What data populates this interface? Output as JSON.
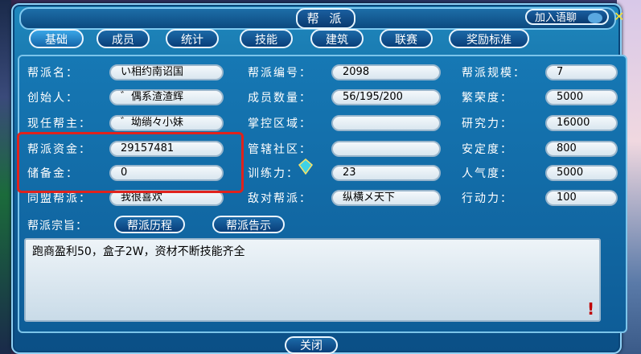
{
  "window": {
    "title": "帮 派",
    "chat_button_label": "加入语聊",
    "close_symbol": "✕"
  },
  "tabs": [
    {
      "label": "基础",
      "active": true
    },
    {
      "label": "成员",
      "active": false
    },
    {
      "label": "统计",
      "active": false
    },
    {
      "label": "技能",
      "active": false
    },
    {
      "label": "建筑",
      "active": false
    },
    {
      "label": "联赛",
      "active": false
    },
    {
      "label": "奖励标准",
      "active": false
    }
  ],
  "info": {
    "col1": [
      {
        "label": "帮派名：",
        "value": "い相约南诏国"
      },
      {
        "label": "创始人：",
        "value": "゛偶系渣渣辉"
      },
      {
        "label": "现任帮主：",
        "value": "゛坳绱々小妹"
      },
      {
        "label": "帮派资金：",
        "value": "29157481"
      },
      {
        "label": "储备金：",
        "value": "0"
      },
      {
        "label": "同盟帮派：",
        "value": "我很喜欢"
      }
    ],
    "col2": [
      {
        "label": "帮派编号：",
        "value": "2098"
      },
      {
        "label": "成员数量：",
        "value": "56/195/200"
      },
      {
        "label": "掌控区域：",
        "value": ""
      },
      {
        "label": "管辖社区：",
        "value": ""
      },
      {
        "label": "训练力：",
        "value": "23"
      },
      {
        "label": "敌对帮派：",
        "value": "纵横メ天下"
      }
    ],
    "col3": [
      {
        "label": "帮派规模：",
        "value": "7"
      },
      {
        "label": "繁荣度：",
        "value": "5000"
      },
      {
        "label": "研究力：",
        "value": "16000"
      },
      {
        "label": "安定度：",
        "value": "800"
      },
      {
        "label": "人气度：",
        "value": "5000"
      },
      {
        "label": "行动力：",
        "value": "100"
      }
    ]
  },
  "purpose": {
    "label": "帮派宗旨：",
    "history_button": "帮派历程",
    "notice_button": "帮派告示",
    "text": "跑商盈利50，盒子2W，资材不断技能齐全",
    "flag_symbol": "!"
  },
  "footer": {
    "close_button": "关闭"
  },
  "colors": {
    "highlight_box": "#e0221c",
    "accent": "#1678b4"
  }
}
